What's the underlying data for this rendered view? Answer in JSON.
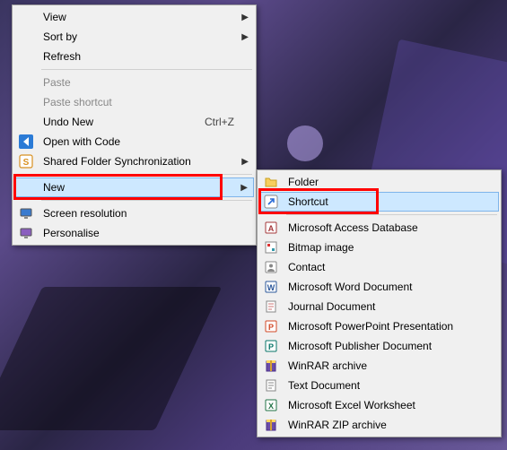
{
  "context_menu": {
    "items": [
      {
        "id": "view",
        "label": "View",
        "submenu": true
      },
      {
        "id": "sort-by",
        "label": "Sort by",
        "submenu": true
      },
      {
        "id": "refresh",
        "label": "Refresh"
      },
      {
        "sep": true
      },
      {
        "id": "paste",
        "label": "Paste",
        "disabled": true
      },
      {
        "id": "paste-shortcut",
        "label": "Paste shortcut",
        "disabled": true
      },
      {
        "id": "undo-new",
        "label": "Undo New",
        "accel": "Ctrl+Z"
      },
      {
        "id": "open-code",
        "label": "Open with Code",
        "icon": "vscode-icon"
      },
      {
        "id": "shared-sync",
        "label": "Shared Folder Synchronization",
        "icon": "s-box-icon",
        "submenu": true
      },
      {
        "sep": true
      },
      {
        "id": "new",
        "label": "New",
        "submenu": true,
        "highlight": true,
        "annot": true
      },
      {
        "sep": true
      },
      {
        "id": "screen-res",
        "label": "Screen resolution",
        "icon": "monitor-icon"
      },
      {
        "id": "personalise",
        "label": "Personalise",
        "icon": "personalise-icon"
      }
    ]
  },
  "new_submenu": {
    "items": [
      {
        "id": "folder",
        "label": "Folder",
        "icon": "folder-icon"
      },
      {
        "id": "shortcut",
        "label": "Shortcut",
        "icon": "shortcut-icon",
        "highlight": true,
        "annot": true
      },
      {
        "sep": true
      },
      {
        "id": "accessdb",
        "label": "Microsoft Access Database",
        "icon": "access-icon"
      },
      {
        "id": "bitmap",
        "label": "Bitmap image",
        "icon": "bitmap-icon"
      },
      {
        "id": "contact",
        "label": "Contact",
        "icon": "contact-icon"
      },
      {
        "id": "worddoc",
        "label": "Microsoft Word Document",
        "icon": "word-icon"
      },
      {
        "id": "journal",
        "label": "Journal Document",
        "icon": "journal-icon"
      },
      {
        "id": "pptx",
        "label": "Microsoft PowerPoint Presentation",
        "icon": "powerpoint-icon"
      },
      {
        "id": "pub",
        "label": "Microsoft Publisher Document",
        "icon": "publisher-icon"
      },
      {
        "id": "rar",
        "label": "WinRAR archive",
        "icon": "winrar-icon"
      },
      {
        "id": "txt",
        "label": "Text Document",
        "icon": "text-icon"
      },
      {
        "id": "xlsx",
        "label": "Microsoft Excel Worksheet",
        "icon": "excel-icon"
      },
      {
        "id": "zip",
        "label": "WinRAR ZIP archive",
        "icon": "winrar-icon"
      }
    ]
  }
}
